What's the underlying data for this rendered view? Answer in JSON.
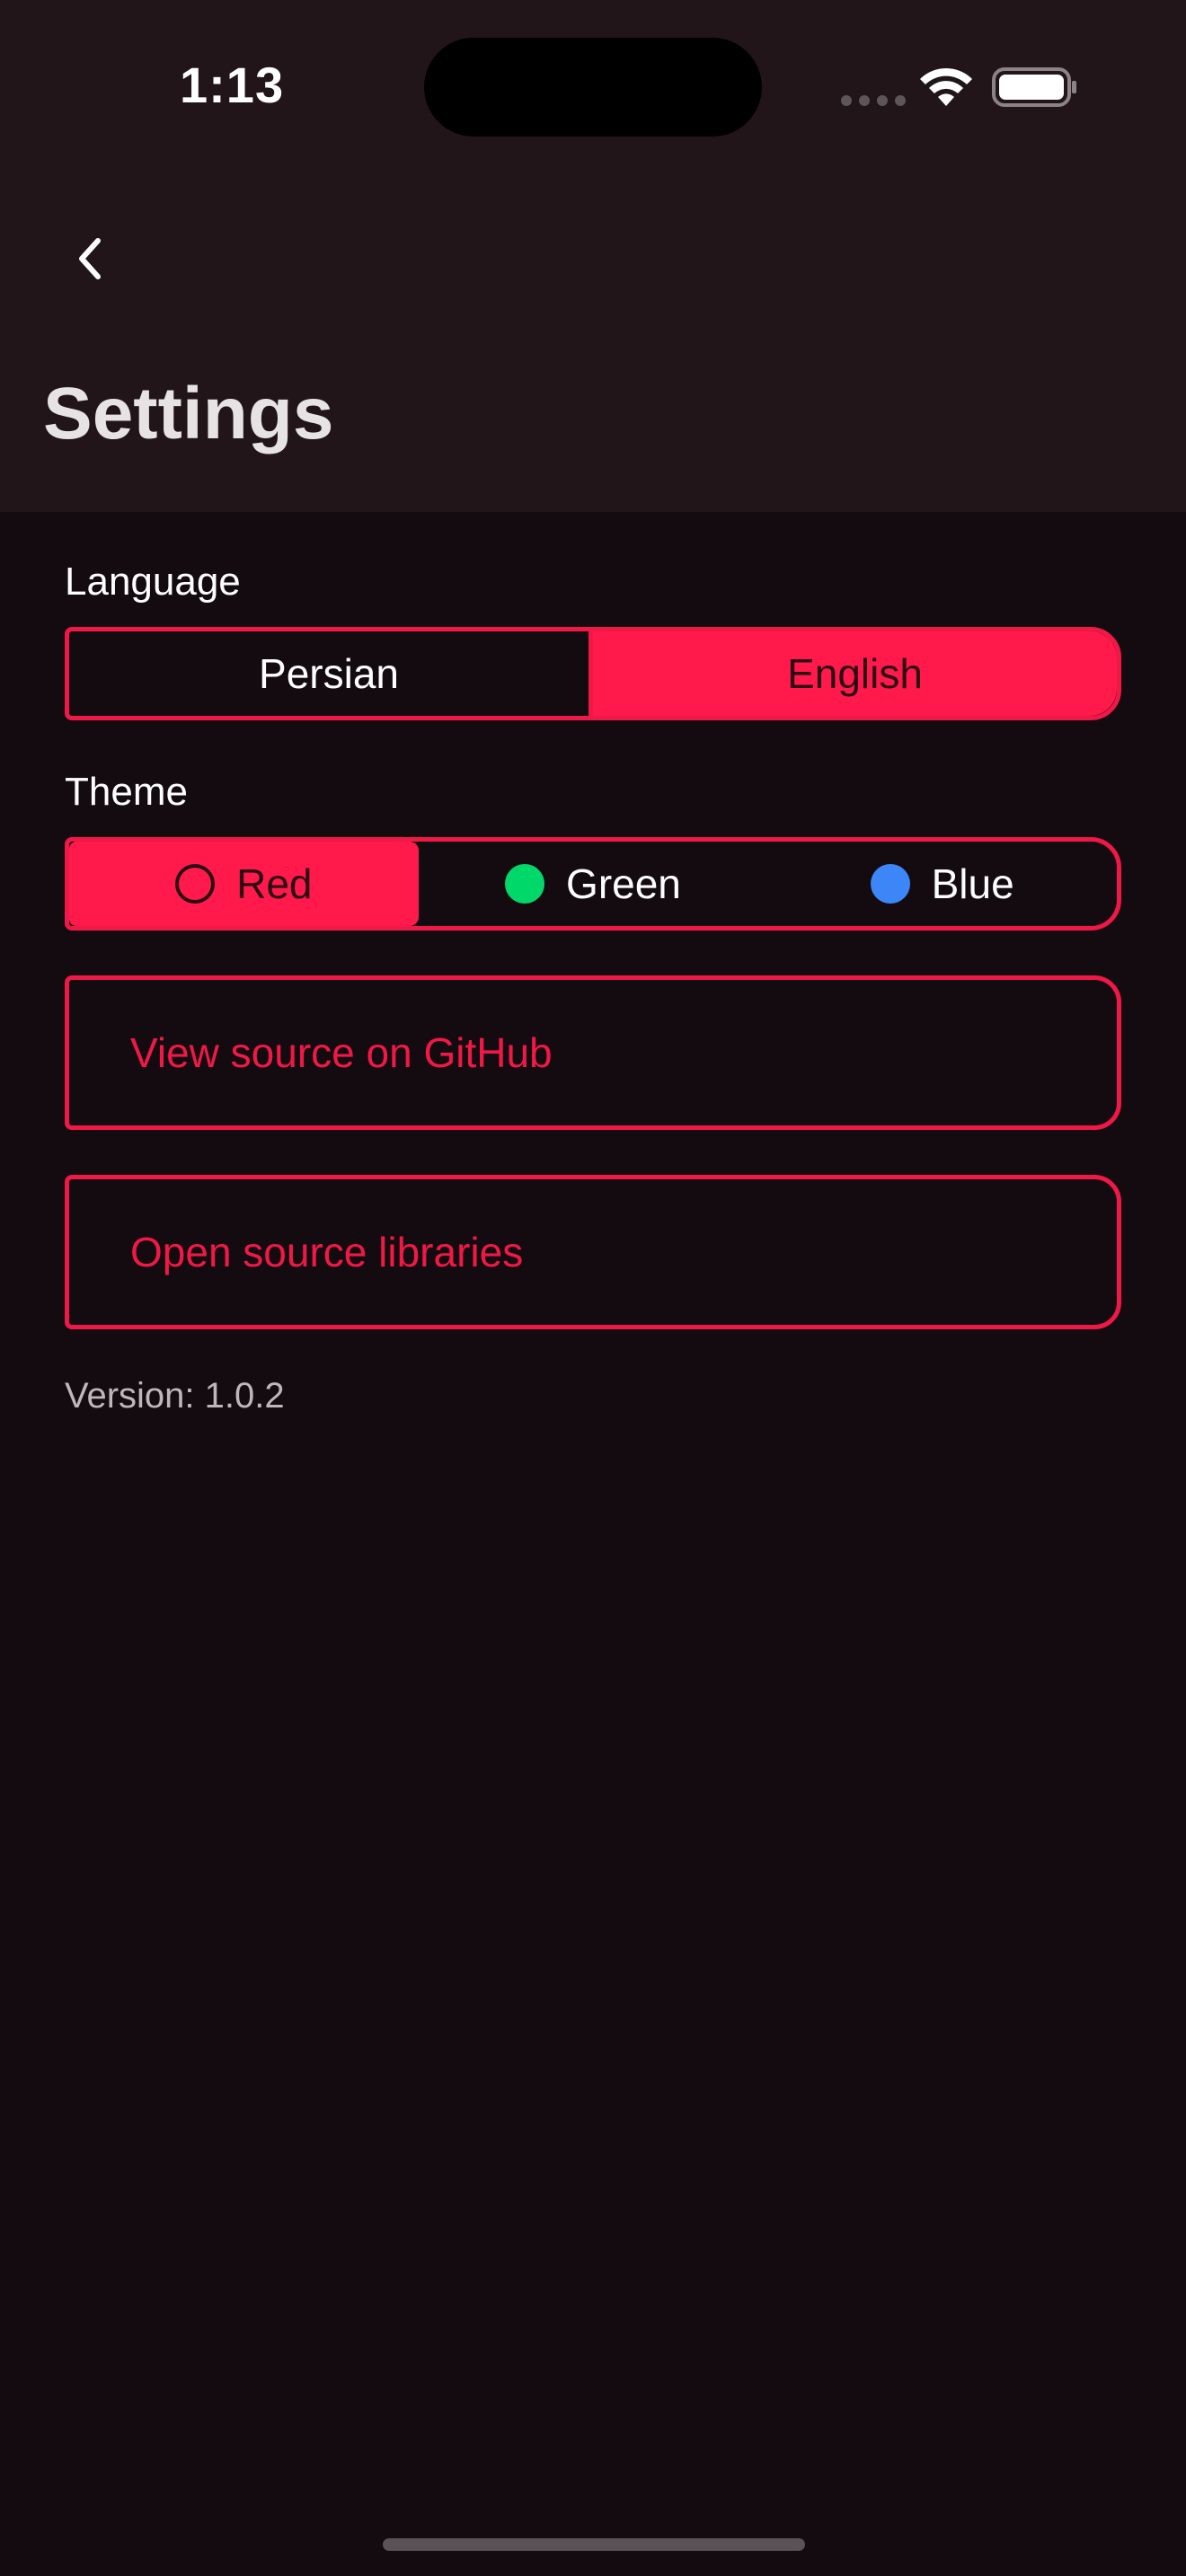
{
  "status_bar": {
    "time": "1:13"
  },
  "nav": {
    "back_icon": "chevron-left-icon",
    "title": "Settings"
  },
  "language": {
    "label": "Language",
    "options": [
      "Persian",
      "English"
    ],
    "selected": "English"
  },
  "theme": {
    "label": "Theme",
    "options": [
      {
        "label": "Red",
        "color": "#ff1a4b"
      },
      {
        "label": "Green",
        "color": "#00d96a"
      },
      {
        "label": "Blue",
        "color": "#3d86f7"
      }
    ],
    "selected": "Red"
  },
  "links": {
    "github": "View source on GitHub",
    "libraries": "Open source libraries"
  },
  "footer": {
    "version": "Version: 1.0.2"
  },
  "colors": {
    "accent": "#ff1a4b",
    "background": "#130b0f",
    "header_background": "#221519"
  }
}
